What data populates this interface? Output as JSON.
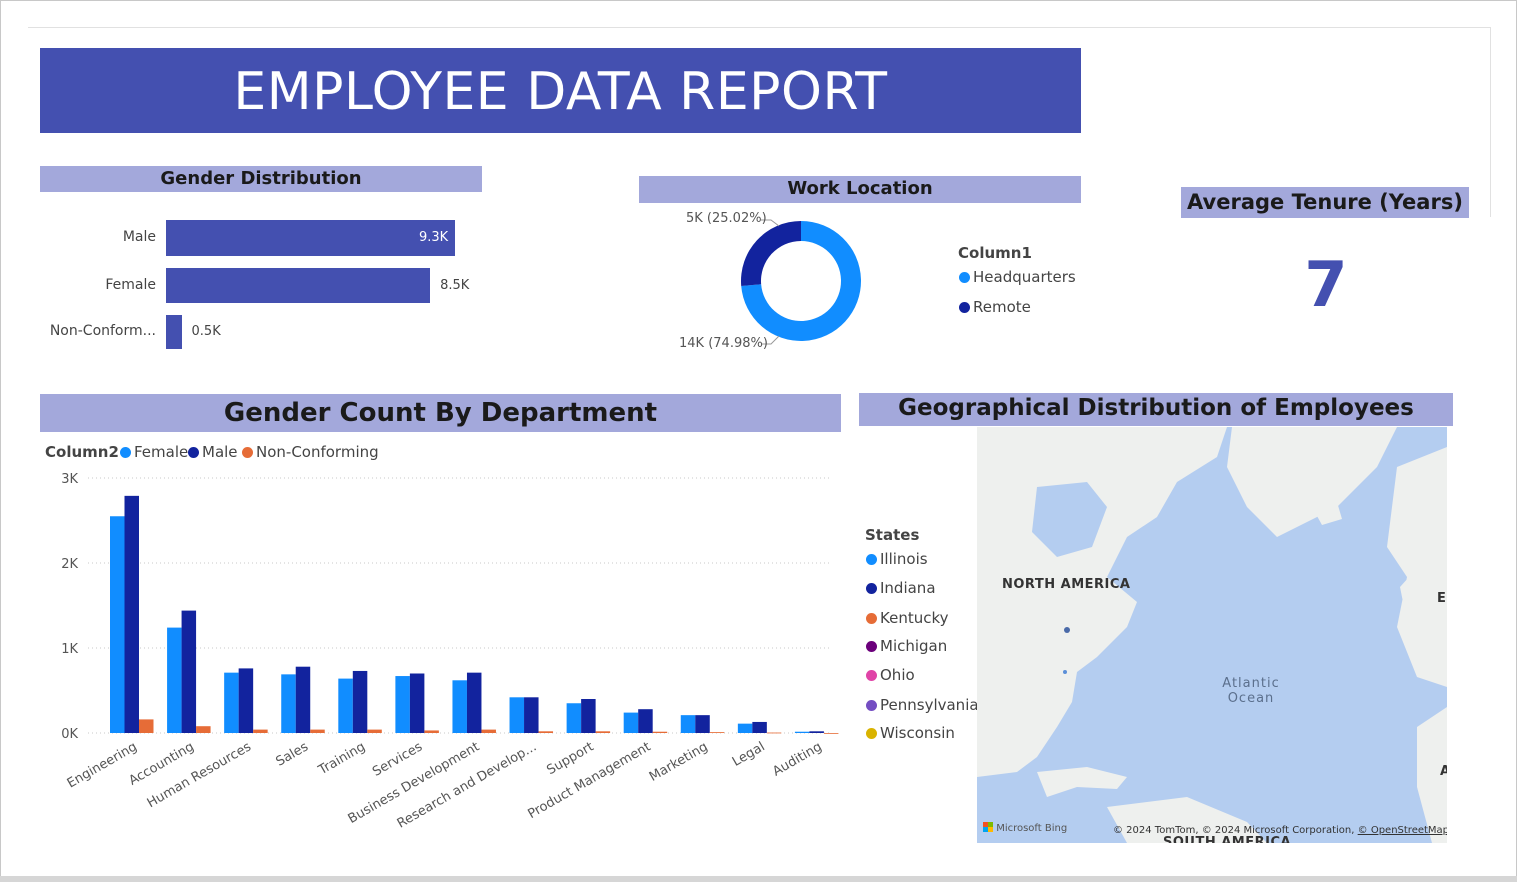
{
  "header": {
    "title": "EMPLOYEE DATA REPORT"
  },
  "gender_distribution": {
    "title": "Gender Distribution",
    "chart_data": {
      "type": "bar",
      "orientation": "horizontal",
      "categories": [
        "Male",
        "Female",
        "Non-Conform..."
      ],
      "values": [
        9.3,
        8.5,
        0.5
      ],
      "value_labels": [
        "9.3K",
        "8.5K",
        "0.5K"
      ],
      "unit": "K",
      "color": "#4450b0"
    }
  },
  "work_location": {
    "title": "Work Location",
    "legend_title": "Column1",
    "chart_data": {
      "type": "pie",
      "variant": "donut",
      "categories": [
        "Headquarters",
        "Remote"
      ],
      "values": [
        14,
        5
      ],
      "percent": [
        74.98,
        25.02
      ],
      "labels": [
        "14K (74.98%)",
        "5K (25.02%)"
      ],
      "colors": [
        "#118dff",
        "#12239e"
      ]
    }
  },
  "tenure": {
    "title": "Average Tenure (Years)",
    "value": "7"
  },
  "dept_chart": {
    "title": "Gender Count By Department",
    "legend_title": "Column2",
    "chart_data": {
      "type": "bar",
      "categories": [
        "Engineering",
        "Accounting",
        "Human Resources",
        "Sales",
        "Training",
        "Services",
        "Business Development",
        "Research and Develop...",
        "Support",
        "Product Management",
        "Marketing",
        "Legal",
        "Auditing"
      ],
      "series": [
        {
          "name": "Female",
          "color": "#118dff",
          "values": [
            2550,
            1240,
            710,
            690,
            640,
            670,
            620,
            420,
            350,
            240,
            210,
            110,
            15
          ]
        },
        {
          "name": "Male",
          "color": "#12239e",
          "values": [
            2790,
            1440,
            760,
            780,
            730,
            700,
            710,
            420,
            400,
            280,
            210,
            130,
            20
          ]
        },
        {
          "name": "Non-Conforming",
          "color": "#e66c37",
          "values": [
            160,
            80,
            40,
            40,
            40,
            30,
            40,
            20,
            20,
            15,
            10,
            5,
            0
          ]
        }
      ],
      "yticks": [
        "0K",
        "1K",
        "2K",
        "3K"
      ],
      "ylim": [
        0,
        3000
      ],
      "grid": true
    }
  },
  "geo": {
    "title": "Geographical Distribution of Employees",
    "legend_title": "States",
    "states": [
      {
        "name": "Illinois",
        "color": "#118dff"
      },
      {
        "name": "Indiana",
        "color": "#12239e"
      },
      {
        "name": "Kentucky",
        "color": "#e66c37"
      },
      {
        "name": "Michigan",
        "color": "#6b007b"
      },
      {
        "name": "Ohio",
        "color": "#e044a7"
      },
      {
        "name": "Pennsylvania",
        "color": "#744ec2"
      },
      {
        "name": "Wisconsin",
        "color": "#d9b300"
      }
    ],
    "map": {
      "continent_label": "NORTH AMERICA",
      "continent_label_south": "SOUTH AMERICA",
      "ocean_label_line1": "Atlantic",
      "ocean_label_line2": "Ocean",
      "edge_label_eu": "EU",
      "edge_label_a": "A",
      "bing_credit": "Microsoft Bing",
      "copyright": "© 2024 TomTom, © 2024 Microsoft Corporation,",
      "osm_link": "© OpenStreetMap"
    }
  }
}
